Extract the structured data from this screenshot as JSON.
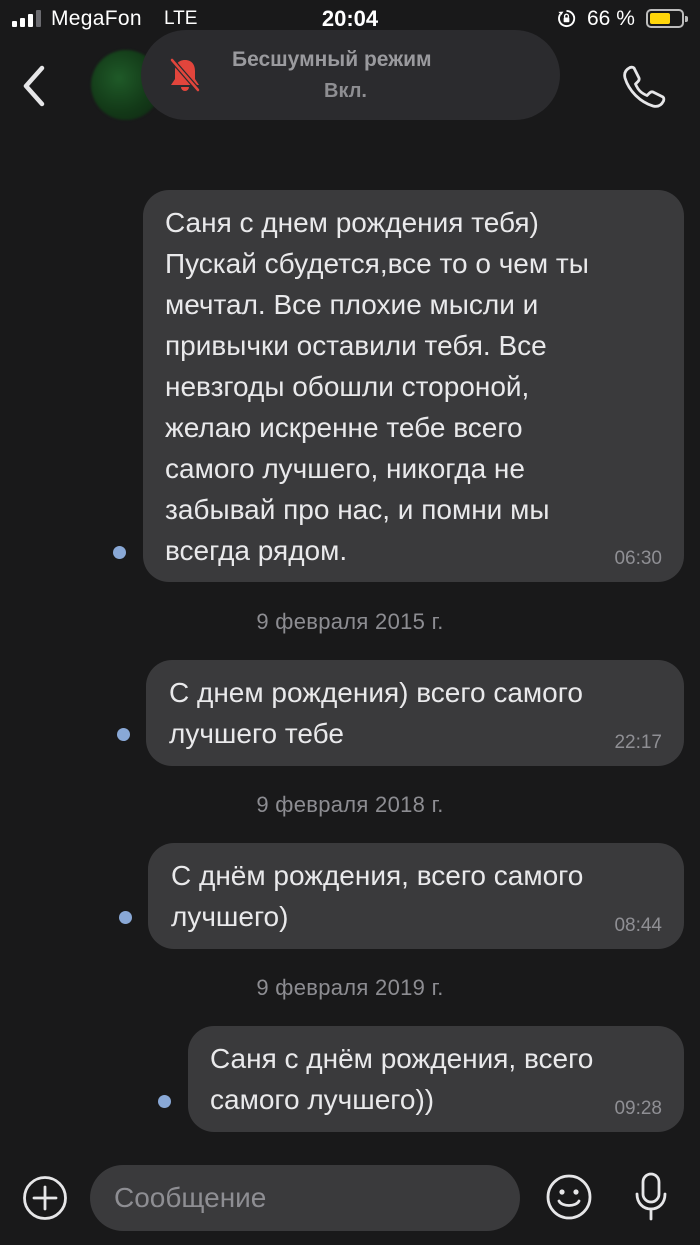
{
  "status_bar": {
    "carrier": "MegaFon",
    "network": "LTE",
    "time": "20:04",
    "battery_percent": "66 %",
    "battery_level": 0.66,
    "icons": [
      "signal-icon",
      "orientation-lock-icon",
      "battery-icon"
    ]
  },
  "header": {
    "back_icon": "chevron-left-icon",
    "call_icon": "phone-icon",
    "silent_mode": {
      "title": "Бесшумный режим",
      "state": "Вкл.",
      "icon": "bell-slash-icon",
      "icon_color": "#e2453c"
    }
  },
  "messages": [
    {
      "text": "Саня с днем рождения тебя)\nПускай сбудется,все то о чем ты\nмечтал. Все плохие мысли и\nпривычки оставили тебя. Все\nневзгоды обошли стороной,\nжелаю искренне тебе всего\nсамого лучшего, никогда не\nзабывай про нас, и помни мы\nвсегда рядом.",
      "time": "06:30"
    },
    {
      "date": "9 февраля 2015 г."
    },
    {
      "text": "С днем рождения) всего самого\nлучшего тебе",
      "time": "22:17"
    },
    {
      "date": "9 февраля 2018 г."
    },
    {
      "text": "С днём рождения, всего самого\nлучшего)",
      "time": "08:44"
    },
    {
      "date": "9 февраля 2019 г."
    },
    {
      "text": "Саня с днём рождения, всего\nсамого лучшего))",
      "time": "09:28"
    }
  ],
  "composer": {
    "placeholder": "Сообщение",
    "icons": [
      "plus-icon",
      "emoji-icon",
      "microphone-icon"
    ]
  },
  "colors": {
    "background": "#19191a",
    "bubble": "#3a3a3c",
    "unread_dot": "#89a8d6",
    "battery_fill": "#ffd60a"
  }
}
